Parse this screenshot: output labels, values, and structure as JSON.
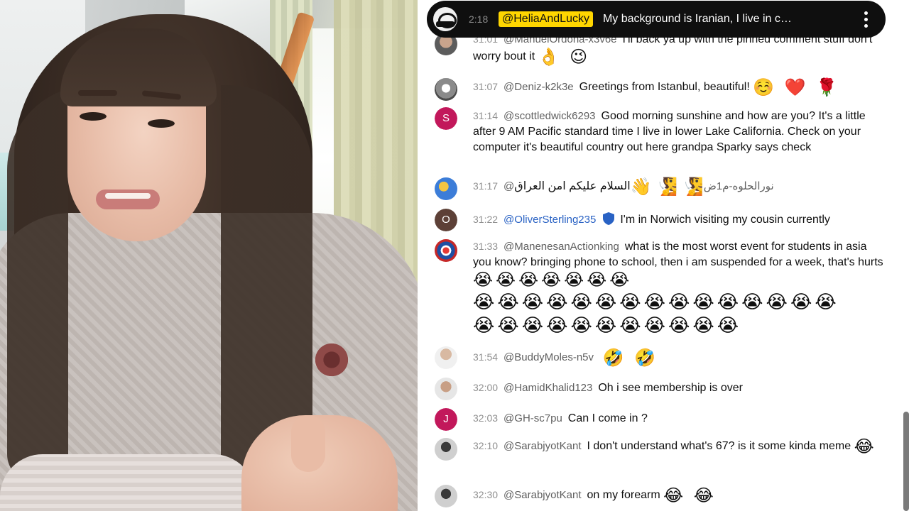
{
  "pinned": {
    "time": "2:18",
    "author": "@HeliaAndLucky",
    "text": "My background is Iranian, I live in c…"
  },
  "messages": [
    {
      "time": "31:01",
      "author": "@ManuelOrdona-x3v6e",
      "text": "I'll back ya up with the pinned comment stuff don't worry bout it",
      "emoji": "👌 😉"
    },
    {
      "time": "31:07",
      "author": "@Deniz-k2k3e",
      "text": "Greetings from Istanbul, beautiful!",
      "emoji": "☺️ ❤️ 🌹"
    },
    {
      "time": "31:14",
      "author": "@scottledwick6293",
      "avatar_letter": "S",
      "text": "Good morning sunshine and how are you? It's a little after 9 AM Pacific standard time I live in lower Lake California. Check on your computer it's beautiful country out here grandpa Sparky says check"
    },
    {
      "time": "31:17",
      "author": "@نورالحلوه-م1ض",
      "text": "السلام عليكم امن العراق",
      "emoji": "🧏 🧏 👋"
    },
    {
      "time": "31:22",
      "author": "@OliverSterling235",
      "avatar_letter": "O",
      "text": "I'm in Norwich visiting my cousin currently"
    },
    {
      "time": "31:33",
      "author": "@ManenesanActionking",
      "text": "what is the most worst event for students in asia you know? bringing phone to school, then i am suspended for a week, that's hurts",
      "emoji": "😭😭😭😭😭😭😭",
      "emoji_line2": "😭😭😭😭😭😭😭😭😭😭😭😭😭😭😭",
      "emoji_line3": "😭😭😭😭😭😭😭😭😭😭😭"
    },
    {
      "time": "31:54",
      "author": "@BuddyMoles-n5v",
      "text": "",
      "emoji": "🤣 🤣"
    },
    {
      "time": "32:00",
      "author": "@HamidKhalid123",
      "text": "Oh i see membership is over"
    },
    {
      "time": "32:03",
      "author": "@GH-sc7pu",
      "avatar_letter": "J",
      "text": "Can I come in ?"
    },
    {
      "time": "32:10",
      "author": "@SarabjyotKant",
      "text": "I don't understand what's 67? is it some kinda meme",
      "emoji": "😂"
    },
    {
      "time": "32:30",
      "author": "@SarabjyotKant",
      "text": "on my forearm",
      "emoji": "😂 😂"
    }
  ],
  "colors": {
    "pinned_bg": "#0f0f0f",
    "author_highlight": "#ffd600",
    "member_blue": "#2962c4",
    "avatar_s": "#c2185b",
    "avatar_o": "#5d4037",
    "avatar_j": "#c2185b"
  }
}
